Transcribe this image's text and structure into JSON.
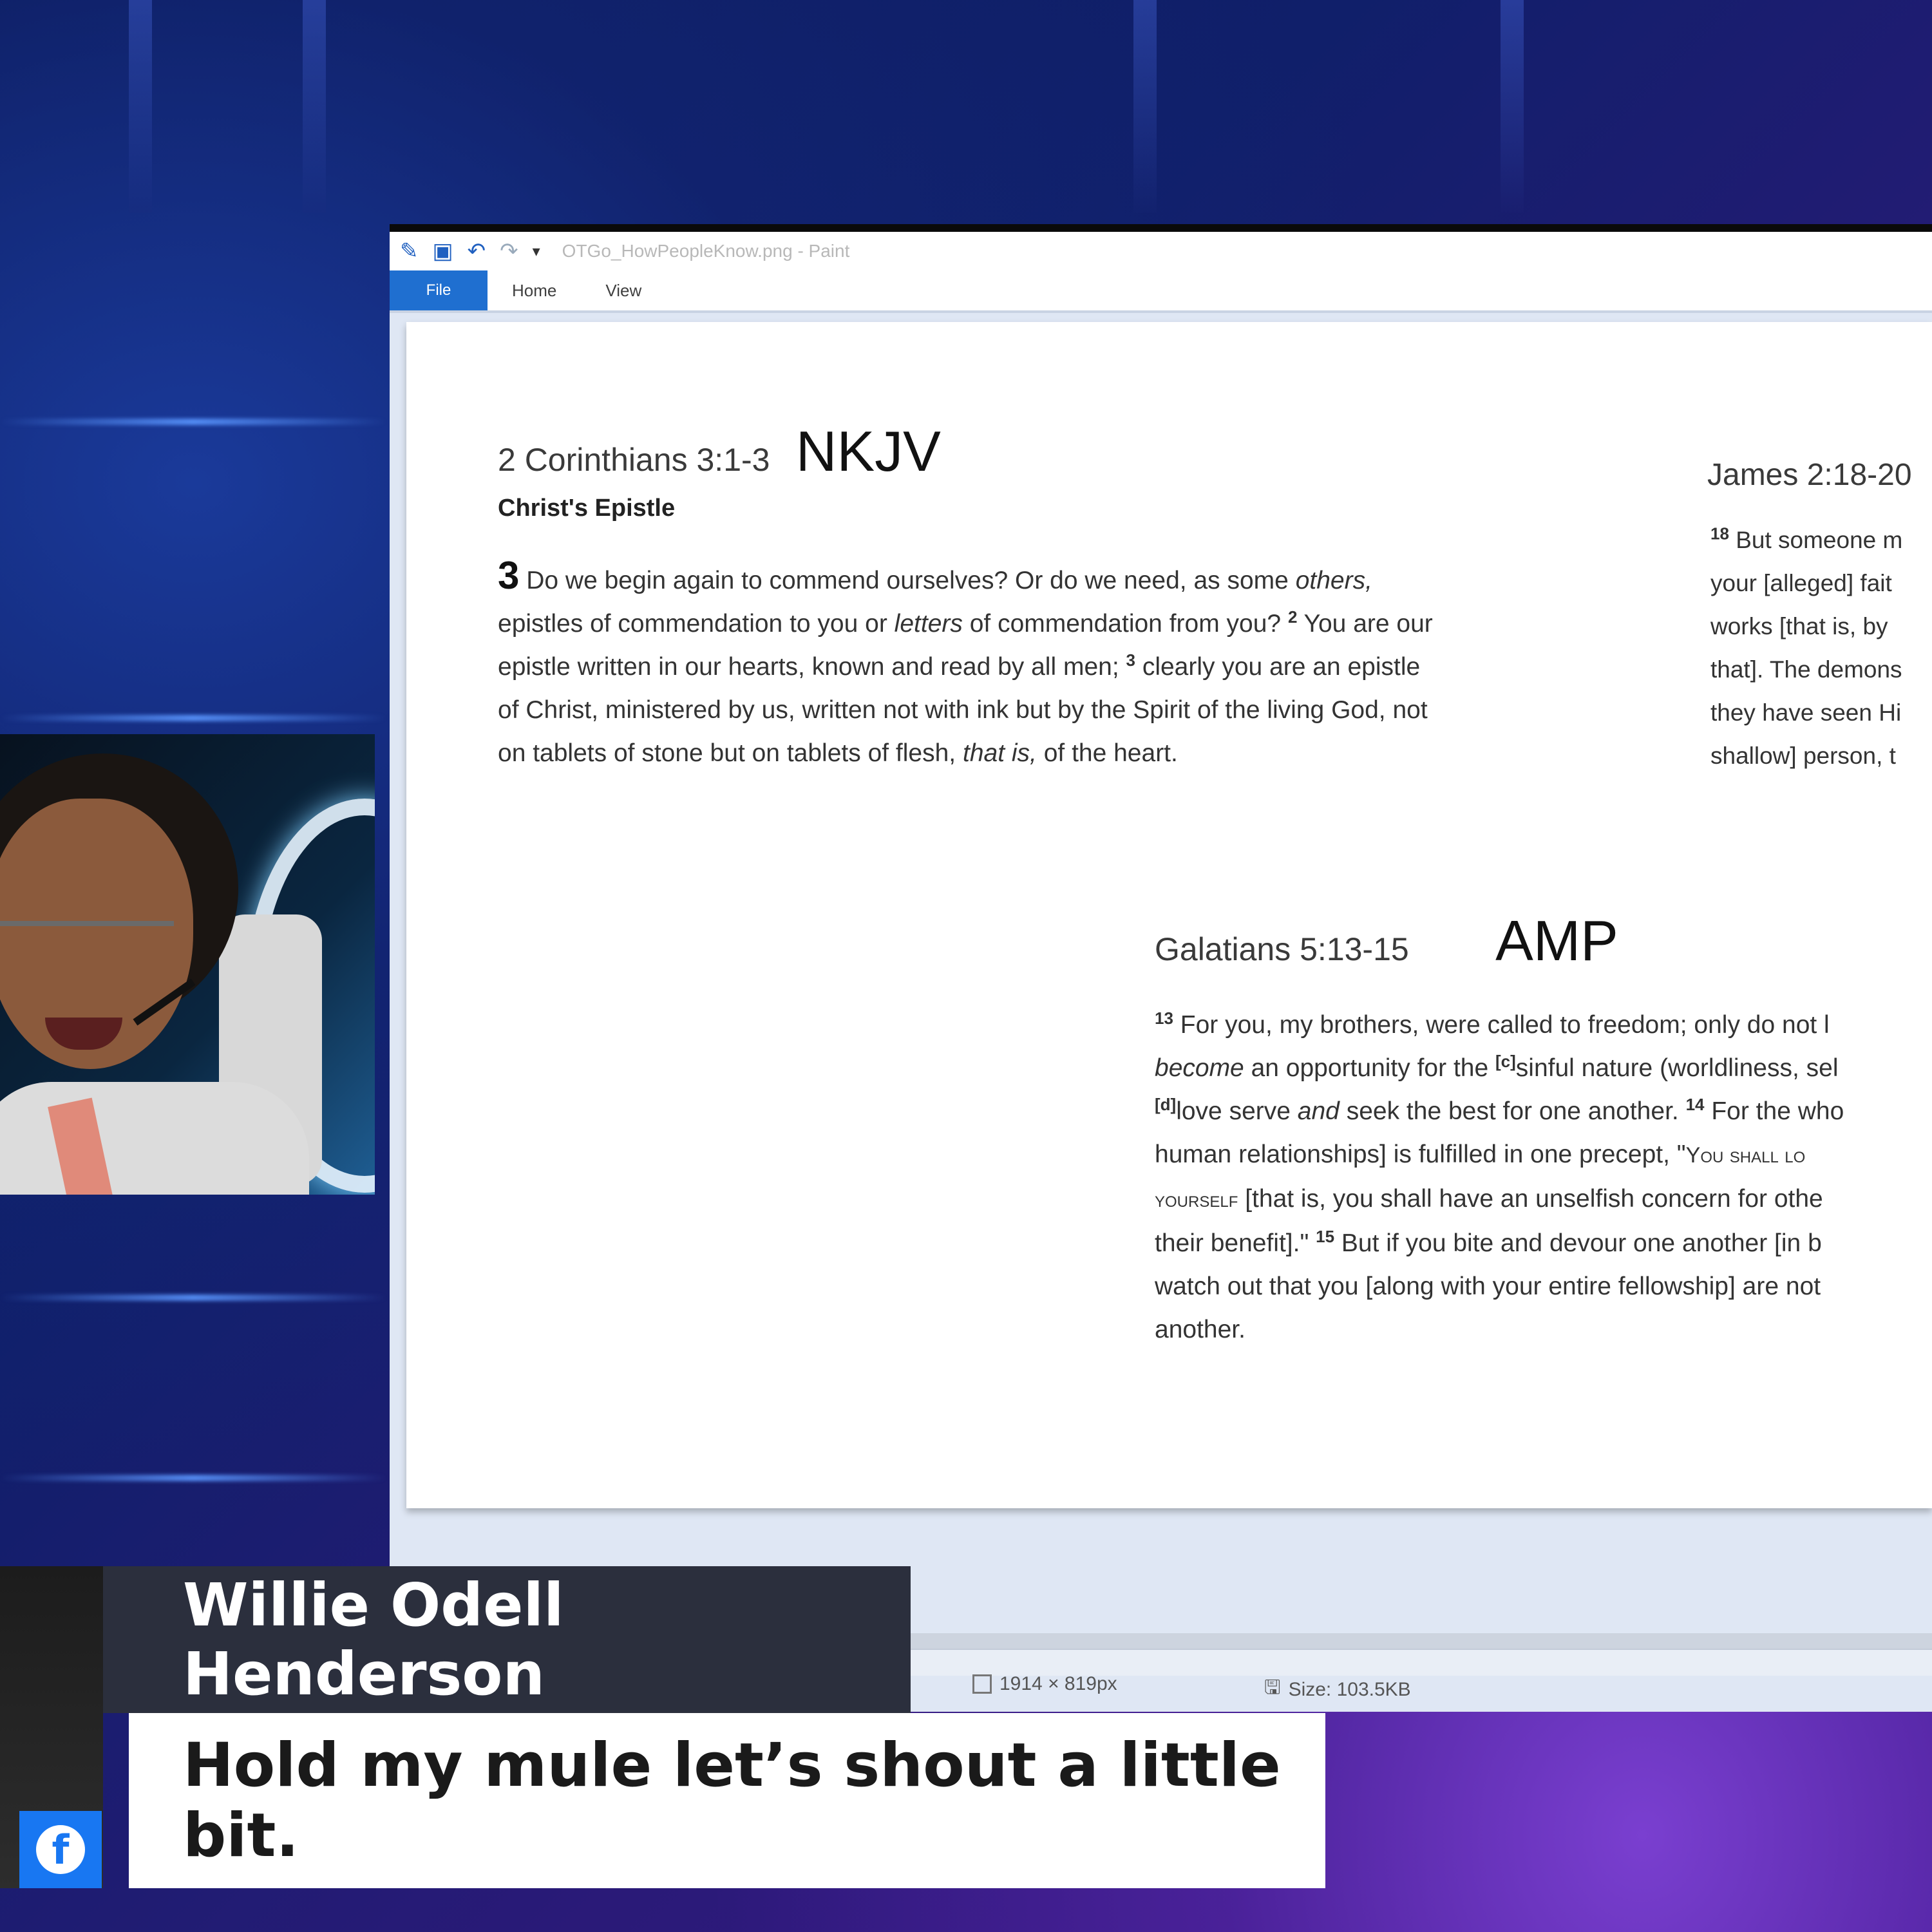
{
  "window": {
    "title": "OTGo_HowPeopleKnow.png - Paint",
    "tabs": [
      "File",
      "Home",
      "View"
    ]
  },
  "canvas": {
    "corinthians": {
      "reference": "2 Corinthians 3:1-3",
      "version": "NKJV",
      "subheading": "Christ's Epistle",
      "chapter": "3",
      "line1": " Do we begin again to commend ourselves? Or do we need, as some ",
      "line1_italic": "others,",
      "line2a": "epistles of commendation to you or ",
      "line2_italic": "letters",
      "line2b": " of commendation from you? ",
      "verse2": "2",
      "line2c": " You are our",
      "line3a": "epistle written in our hearts, known and read by all men; ",
      "verse3": "3",
      "line3b": " clearly you are an epistle",
      "line4": "of Christ, ministered by us, written not with ink but by the Spirit of the living God, not",
      "line5a": "on tablets of stone but on tablets of flesh, ",
      "line5_italic": "that is,",
      "line5b": " of the heart."
    },
    "james": {
      "reference": "James 2:18-20",
      "verse18": "18",
      "line1": " But someone m",
      "line2": "your [alleged] fait",
      "line3": "works [that is, by",
      "line4": "that]. The demons",
      "line5": "they have seen Hi",
      "line6": "shallow] person, t"
    },
    "galatians": {
      "reference": "Galatians 5:13-15",
      "version": "AMP",
      "verse13": "13",
      "line1": " For you, my brothers, were called to freedom; only do not l",
      "line2_italic": "become",
      "line2a": " an opportunity for the ",
      "fn_c": "[c]",
      "line2b": "sinful nature (worldliness, sel",
      "fn_d": "[d]",
      "line3a": "love serve ",
      "line3_italic": "and",
      "line3b": " seek the best for one another. ",
      "verse14": "14",
      "line3c": " For the who",
      "line4a": "human relationships] is fulfilled in one precept, \"",
      "line4_sc": "You shall lo",
      "line5_sc": "yourself",
      "line5a": " [that is, you shall have an unselfish concern for othe",
      "line6a": "their benefit].\" ",
      "verse15": "15",
      "line6b": " But if you bite and devour one another [in b",
      "line7": "watch out that you [along with your entire fellowship] are not",
      "line8": "another."
    }
  },
  "statusbar": {
    "dimensions": "1914 × 819px",
    "size": "Size: 103.5KB"
  },
  "lower_third": {
    "name": "Willie Odell Henderson",
    "message": "Hold my mule let’s shout a little bit.",
    "platform_icon": "facebook-icon",
    "platform_letter": "f"
  }
}
